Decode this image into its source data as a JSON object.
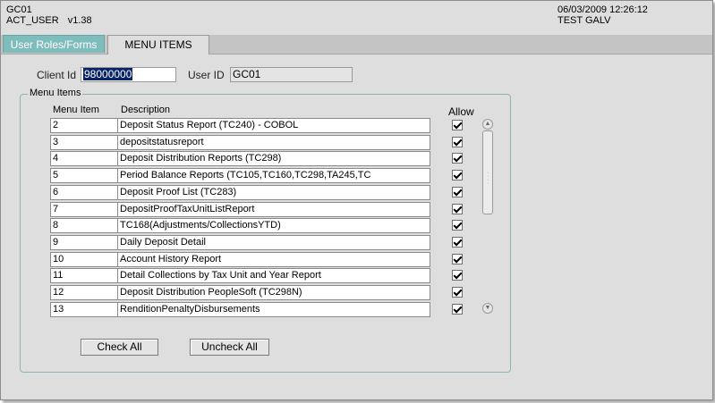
{
  "header": {
    "app_code": "GC01",
    "user": "ACT_USER",
    "version": "v1.38",
    "datetime": "06/03/2009 12:26:12",
    "env": "TEST GALV"
  },
  "tabs": [
    {
      "label": "User Roles/Forms",
      "active": false
    },
    {
      "label": "MENU ITEMS",
      "active": true
    }
  ],
  "form": {
    "client_id_label": "Client Id",
    "client_id_value": "98000000",
    "user_id_label": "User ID",
    "user_id_value": "GC01"
  },
  "menu_items": {
    "legend": "Menu Items",
    "col_item": "Menu Item",
    "col_desc": "Description",
    "col_allow": "Allow",
    "rows": [
      {
        "item": "2",
        "description": "Deposit Status Report (TC240) - COBOL",
        "allow": true
      },
      {
        "item": "3",
        "description": "depositstatusreport",
        "allow": true
      },
      {
        "item": "4",
        "description": "Deposit Distribution Reports (TC298)",
        "allow": true
      },
      {
        "item": "5",
        "description": "Period Balance Reports (TC105,TC160,TC298,TA245,TC",
        "allow": true
      },
      {
        "item": "6",
        "description": "Deposit Proof List (TC283)",
        "allow": true
      },
      {
        "item": "7",
        "description": "DepositProofTaxUnitListReport",
        "allow": true
      },
      {
        "item": "8",
        "description": "TC168(Adjustments/CollectionsYTD)",
        "allow": true
      },
      {
        "item": "9",
        "description": "Daily Deposit Detail",
        "allow": true
      },
      {
        "item": "10",
        "description": "Account History Report",
        "allow": true
      },
      {
        "item": "11",
        "description": "Detail Collections by Tax Unit and Year Report",
        "allow": true
      },
      {
        "item": "12",
        "description": "Deposit Distribution PeopleSoft (TC298N)",
        "allow": true
      },
      {
        "item": "13",
        "description": "RenditionPenaltyDisbursements",
        "allow": true
      }
    ]
  },
  "buttons": {
    "check_all": "Check All",
    "uncheck_all": "Uncheck All"
  },
  "icons": {
    "scroll_up": "scroll-up-arrow-icon",
    "scroll_down": "scroll-down-arrow-icon",
    "checkbox": "checkmark-icon"
  },
  "colors": {
    "active_tab_bg": "#7fbcbc",
    "selection_bg": "#0a246a",
    "window_bg": "#dedede"
  }
}
